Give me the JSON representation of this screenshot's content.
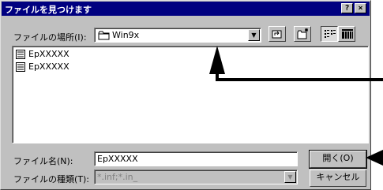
{
  "dialog": {
    "title": "ファイルを見つけます",
    "help_button": "?",
    "close_button": "×"
  },
  "look_in": {
    "label": "ファイルの場所(I):",
    "value": "Win9x"
  },
  "files": [
    {
      "name": "EpXXXXX"
    },
    {
      "name": "EpXXXXX"
    }
  ],
  "filename": {
    "label": "ファイル名(N):",
    "value": "EpXXXXX"
  },
  "filetype": {
    "label": "ファイルの種類(T):",
    "value": "*.inf;*.in_"
  },
  "buttons": {
    "open": "開く(O)",
    "cancel": "キャンセル"
  }
}
